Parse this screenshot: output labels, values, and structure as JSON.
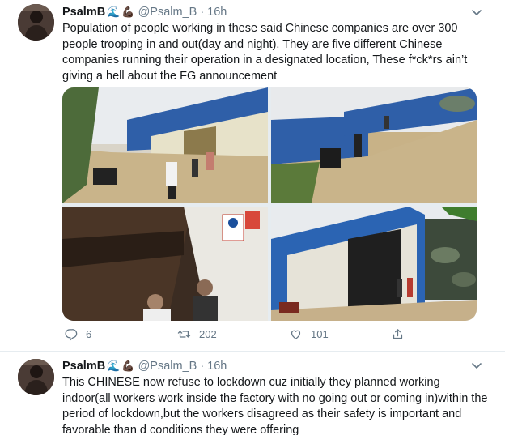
{
  "tweets": [
    {
      "author": {
        "name": "PsalmB",
        "handle": "@Psalm_B",
        "separator": "·",
        "time": "16h",
        "emoji": [
          "wave-emoji",
          "flexed-biceps-emoji"
        ]
      },
      "text": "Population of people working in these said Chinese companies are over 300 people trooping in and out(day and night). They are five different Chinese companies running their operation in a designated location, These f*ck*rs ain’t giving a hell about the FG announcement",
      "media": [
        {
          "icon": "photo-warehouse-street"
        },
        {
          "icon": "photo-warehouse-yard"
        },
        {
          "icon": "photo-workers-entrance"
        },
        {
          "icon": "photo-blue-warehouse"
        }
      ],
      "actions": {
        "replies": "6",
        "retweets": "202",
        "likes": "101",
        "icons": [
          "reply-icon",
          "retweet-icon",
          "like-icon",
          "share-icon"
        ]
      }
    },
    {
      "author": {
        "name": "PsalmB",
        "handle": "@Psalm_B",
        "separator": "·",
        "time": "16h",
        "emoji": [
          "wave-emoji",
          "flexed-biceps-emoji"
        ]
      },
      "text": "This CHINESE now refuse to lockdown cuz initially they planned working indoor(all workers work inside the factory with no going out or coming in)within the period of lockdown,but the workers disagreed as their safety is important and favorable than d conditions they were offering"
    }
  ],
  "colors": {
    "text": "#14171a",
    "secondary": "#657786",
    "accent": "#1da1f2",
    "divider": "#e6ecf0"
  }
}
